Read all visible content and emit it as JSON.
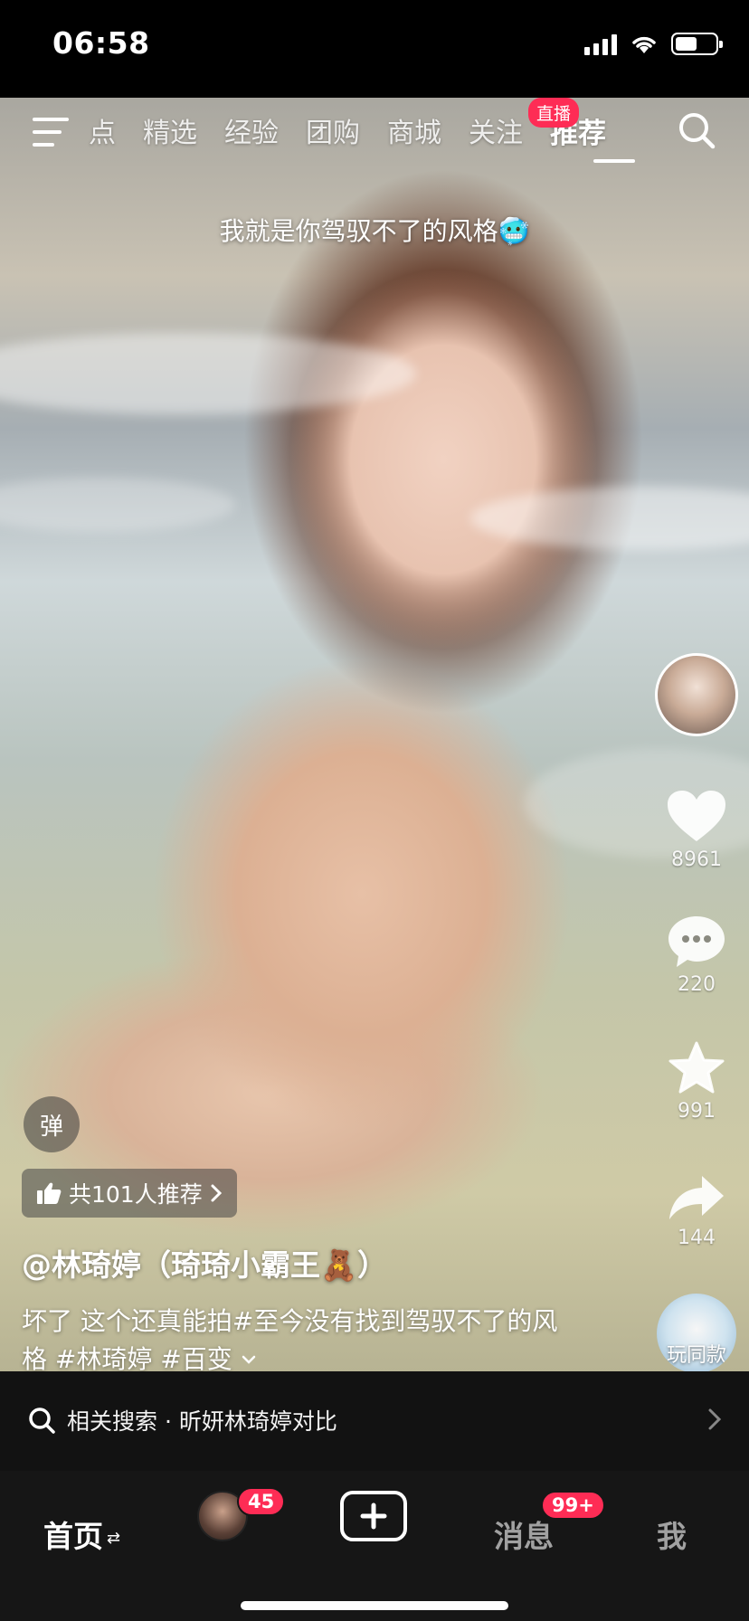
{
  "status": {
    "time": "06:58",
    "battery_level": 0.55
  },
  "nav": {
    "tabs": [
      {
        "label": "点"
      },
      {
        "label": "精选"
      },
      {
        "label": "经验"
      },
      {
        "label": "团购"
      },
      {
        "label": "商城"
      },
      {
        "label": "关注"
      },
      {
        "label": "推荐"
      }
    ],
    "active_tab": "推荐",
    "live_badge": "直播"
  },
  "video": {
    "overlay_caption": "我就是你驾驭不了的风格🥶"
  },
  "rail": {
    "likes": "8961",
    "comments": "220",
    "favorites": "991",
    "shares": "144",
    "same_style_label": "玩同款"
  },
  "post": {
    "danmu_label": "弹",
    "recommend_chip": "共101人推荐",
    "author": "@林琦婷（琦琦小霸王🧸）",
    "description": "坏了 这个还真能拍#至今没有找到驾驭不了的风格 #林琦婷 #百变"
  },
  "related_search": {
    "label": "相关搜索 · 昕妍林琦婷对比"
  },
  "tabbar": {
    "home": "首页",
    "friends_badge": "45",
    "messages": "消息",
    "messages_badge": "99+",
    "me": "我"
  },
  "colors": {
    "accent": "#fe2c55",
    "tabbar_bg": "#161616"
  }
}
